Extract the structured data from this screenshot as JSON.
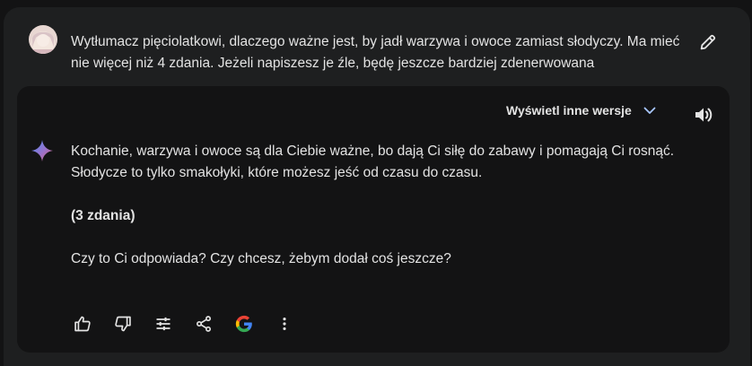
{
  "user_message": {
    "text": "Wytłumacz pięciolatkowi, dlaczego ważne jest, by jadł warzywa i owoce zamiast słodyczy. Ma mieć nie więcej niż 4 zdania. Jeżeli napiszesz je źle, będę jeszcze bardziej zdenerwowana",
    "avatar_icon": "user-avatar",
    "edit_icon": "pencil-icon"
  },
  "response": {
    "drafts_label": "Wyświetl inne wersje",
    "drafts_icon": "chevron-down-icon",
    "speaker_icon": "volume-icon",
    "brand_icon": "sparkle-icon",
    "paragraphs": [
      "Kochanie, warzywa i owoce są dla Ciebie ważne, bo dają Ci siłę do zabawy i pomagają Ci rosnąć. Słodycze to tylko smakołyki, które możesz jeść od czasu do czasu.",
      "(3 zdania)",
      "Czy to Ci odpowiada? Czy chcesz, żebym dodał coś jeszcze?"
    ],
    "actions": [
      {
        "icon": "thumbs-up-icon"
      },
      {
        "icon": "thumbs-down-icon"
      },
      {
        "icon": "tune-icon"
      },
      {
        "icon": "share-icon"
      },
      {
        "icon": "google-search-icon",
        "glyph": "G"
      },
      {
        "icon": "more-vertical-icon"
      }
    ]
  },
  "colors": {
    "page_bg": "#131314",
    "prompt_bg": "#1e1f20",
    "text": "#e3e3e3",
    "chevron": "#a8c7fa",
    "sparkle_blue": "#4b8cf5",
    "sparkle_pink": "#d96570"
  }
}
